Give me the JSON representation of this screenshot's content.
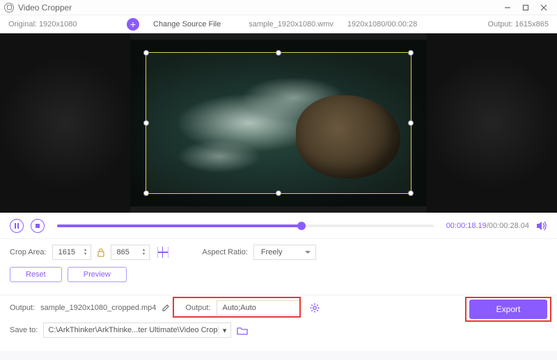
{
  "window": {
    "title": "Video Cropper"
  },
  "info": {
    "original_label": "Original:",
    "original_res": "1920x1080",
    "change_source": "Change Source File",
    "source_file": "sample_1920x1080.wmv",
    "source_meta": "1920x1080/00:00:28",
    "output_label": "Output:",
    "output_res": "1615x865"
  },
  "playback": {
    "current": "00:00:18.19",
    "total": "00:00:28.04"
  },
  "crop": {
    "area_label": "Crop Area:",
    "width": "1615",
    "height": "865",
    "aspect_label": "Aspect Ratio:",
    "aspect_value": "Freely",
    "reset": "Reset",
    "preview": "Preview"
  },
  "output": {
    "label": "Output:",
    "filename": "sample_1920x1080_cropped.mp4",
    "format_label": "Output:",
    "format_value": "Auto;Auto",
    "saveto_label": "Save to:",
    "saveto_path": "C:\\ArkThinker\\ArkThinke...ter Ultimate\\Video Crop",
    "export": "Export"
  }
}
